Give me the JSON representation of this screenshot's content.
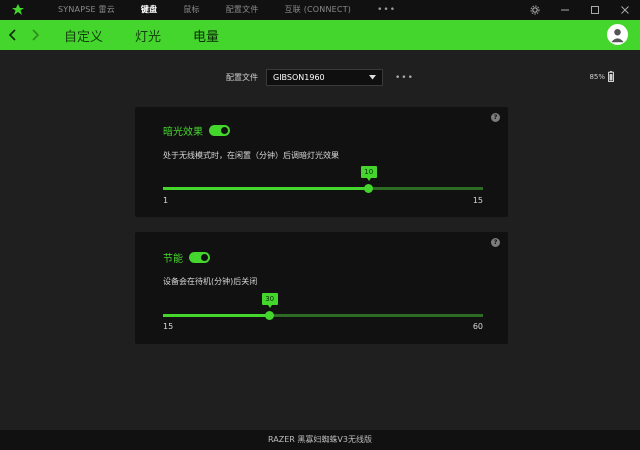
{
  "titlebar": {
    "nav": [
      {
        "label": "SYNAPSE 雷云",
        "active": false
      },
      {
        "label": "键盘",
        "active": true
      },
      {
        "label": "鼠标",
        "active": false
      },
      {
        "label": "配置文件",
        "active": false
      },
      {
        "label": "互联 (CONNECT)",
        "active": false
      }
    ],
    "more": "•••"
  },
  "subnav": {
    "tabs": [
      {
        "label": "自定义"
      },
      {
        "label": "灯光"
      },
      {
        "label": "电量"
      }
    ]
  },
  "profile": {
    "label": "配置文件",
    "selected": "GIBSON1960",
    "more": "•••"
  },
  "battery": {
    "percent": "85%",
    "level": 0.85
  },
  "dim_card": {
    "title": "暗光效果",
    "enabled": true,
    "description": "处于无线模式时，在闲置（分钟）后调暗灯光效果",
    "min": 1,
    "max": 15,
    "value": 10,
    "min_label": "1",
    "max_label": "15",
    "value_label": "10"
  },
  "sleep_card": {
    "title": "节能",
    "enabled": true,
    "description": "设备会在待机(分钟)后关闭",
    "min": 15,
    "max": 60,
    "value": 30,
    "min_label": "15",
    "max_label": "60",
    "value_label": "30"
  },
  "footer": {
    "device": "RAZER 黑寡妇蜘蛛V3无线版"
  },
  "colors": {
    "accent": "#44d62c",
    "background": "#1f1f1f",
    "card": "#111111"
  }
}
